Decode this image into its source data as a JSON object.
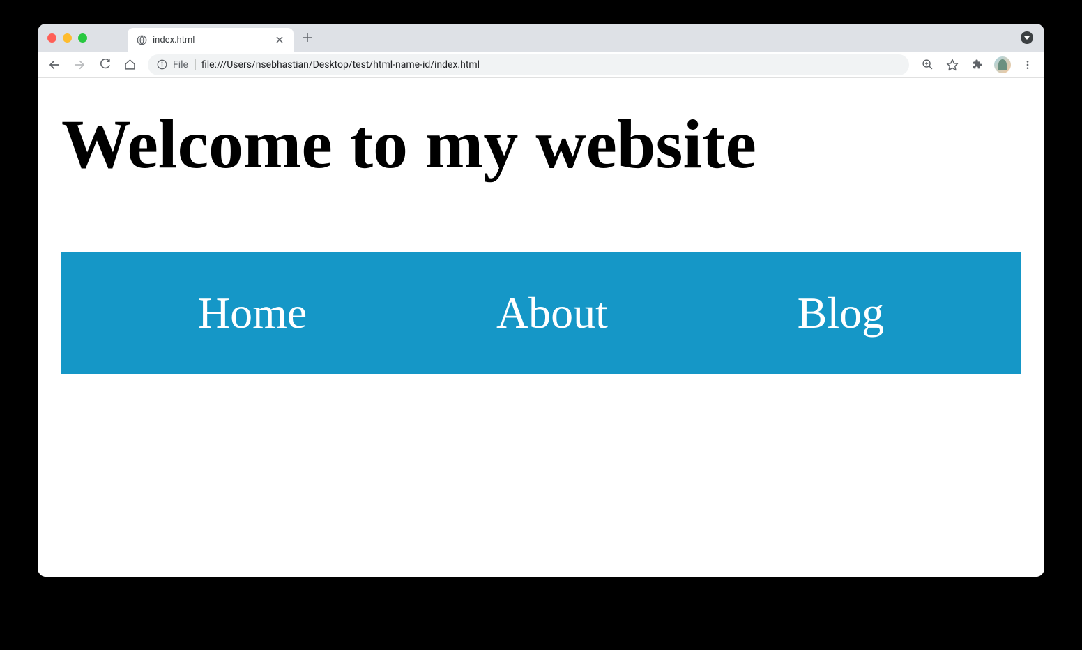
{
  "browser": {
    "tab": {
      "title": "index.html"
    },
    "toolbar": {
      "url_prefix": "File",
      "url": "file:///Users/nsebhastian/Desktop/test/html-name-id/index.html"
    }
  },
  "page": {
    "heading": "Welcome to my website",
    "nav": {
      "items": [
        {
          "label": "Home"
        },
        {
          "label": "About"
        },
        {
          "label": "Blog"
        }
      ]
    }
  },
  "colors": {
    "nav_bg": "#1597c7",
    "nav_text": "#ffffff"
  }
}
